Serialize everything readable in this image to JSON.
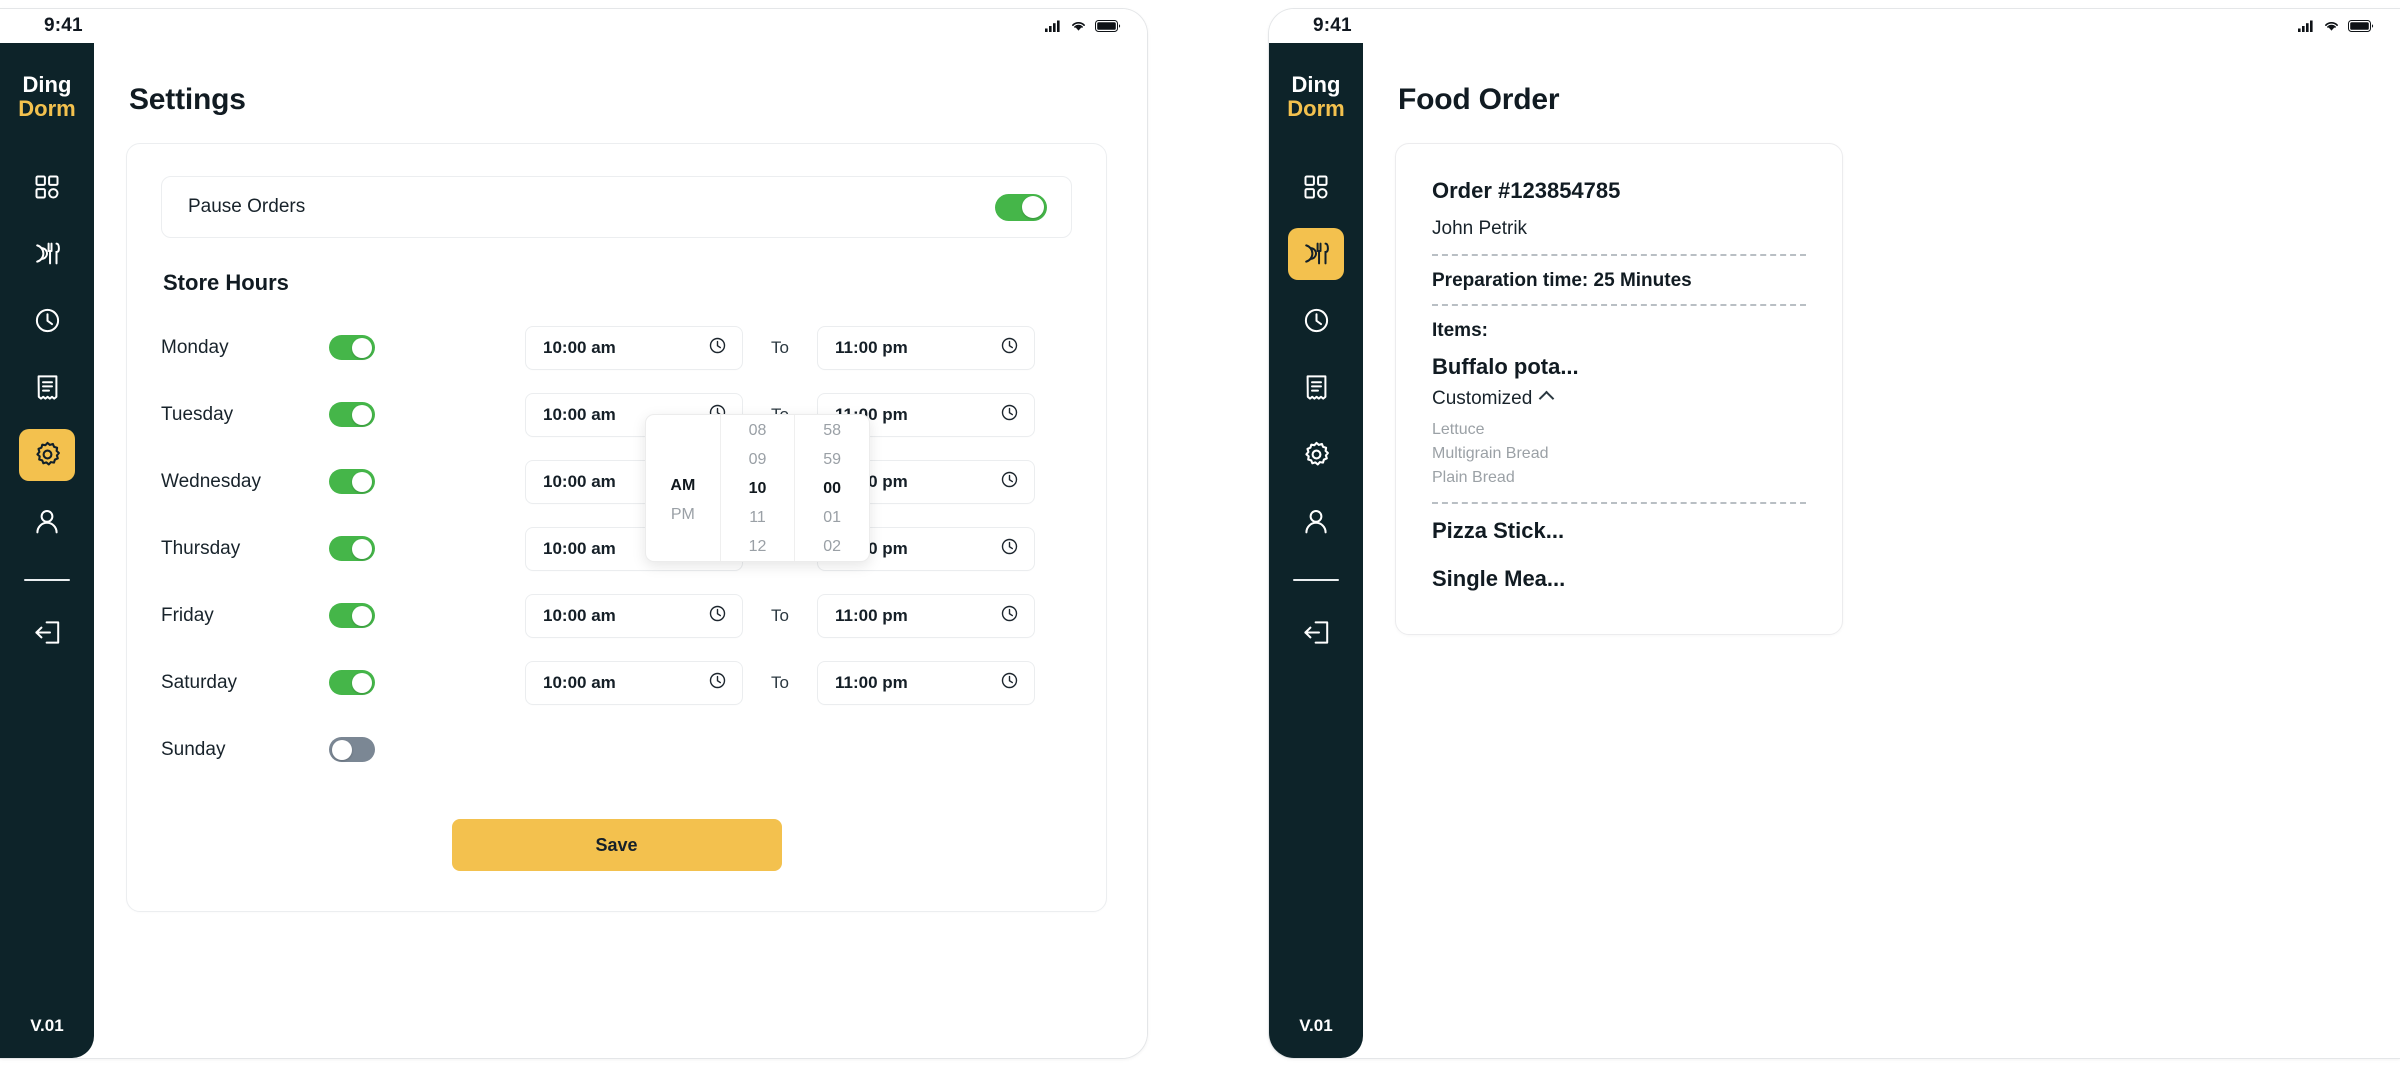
{
  "brand": {
    "line1": "Ding",
    "line2": "Dorm",
    "version": "V.01"
  },
  "status_bar": {
    "time": "9:41"
  },
  "colors": {
    "sidebar_bg": "#0d2329",
    "accent_yellow": "#f3c14e",
    "toggle_on_green": "#45b649",
    "toggle_off_gray": "#7b8794",
    "text_dark": "#111b22"
  },
  "sidebar": {
    "items": [
      {
        "icon": "grid-dashboard-icon",
        "name": "dashboard"
      },
      {
        "icon": "cutlery-food-icon",
        "name": "food-orders"
      },
      {
        "icon": "clock-icon",
        "name": "schedule"
      },
      {
        "icon": "receipt-icon",
        "name": "receipts"
      },
      {
        "icon": "gear-icon",
        "name": "settings"
      },
      {
        "icon": "person-icon",
        "name": "account"
      }
    ],
    "logout": {
      "icon": "logout-icon",
      "name": "logout"
    }
  },
  "left_panel": {
    "page_title": "Settings",
    "active_nav": "settings",
    "pause_orders": {
      "label": "Pause Orders",
      "enabled": true
    },
    "store_hours_title": "Store Hours",
    "to_label": "To",
    "days": [
      {
        "name": "Monday",
        "enabled": true,
        "open": "10:00 am",
        "close": "11:00 pm"
      },
      {
        "name": "Tuesday",
        "enabled": true,
        "open": "10:00 am",
        "close": "11:00 pm"
      },
      {
        "name": "Wednesday",
        "enabled": true,
        "open": "10:00 am",
        "close": "11:00 pm"
      },
      {
        "name": "Thursday",
        "enabled": true,
        "open": "10:00 am",
        "close": "11:00 pm"
      },
      {
        "name": "Friday",
        "enabled": true,
        "open": "10:00 am",
        "close": "11:00 pm"
      },
      {
        "name": "Saturday",
        "enabled": true,
        "open": "10:00 am",
        "close": "11:00 pm"
      },
      {
        "name": "Sunday",
        "enabled": false,
        "open": "",
        "close": ""
      }
    ],
    "time_picker": {
      "open_for_day": "Monday",
      "meridiem": {
        "options": [
          "AM",
          "PM"
        ],
        "selected": "AM"
      },
      "hours": {
        "options": [
          "08",
          "09",
          "10",
          "11",
          "12"
        ],
        "selected": "10"
      },
      "minutes": {
        "options": [
          "58",
          "59",
          "00",
          "01",
          "02"
        ],
        "selected": "00"
      }
    },
    "save_label": "Save"
  },
  "right_panel": {
    "page_title": "Food Order",
    "active_nav": "food-orders",
    "order": {
      "order_id": "Order #123854785",
      "customer": "John Petrik",
      "prep_time": "Preparation time: 25 Minutes",
      "items_label": "Items:",
      "items": [
        {
          "name": "Buffalo pota...",
          "customized_label": "Customized",
          "expanded": true,
          "options": [
            "Lettuce",
            "Multigrain Bread",
            "Plain Bread"
          ]
        },
        {
          "name": "Pizza Stick...",
          "customized_label": "",
          "expanded": false,
          "options": []
        },
        {
          "name": "Single Mea...",
          "customized_label": "",
          "expanded": false,
          "options": []
        }
      ]
    }
  }
}
